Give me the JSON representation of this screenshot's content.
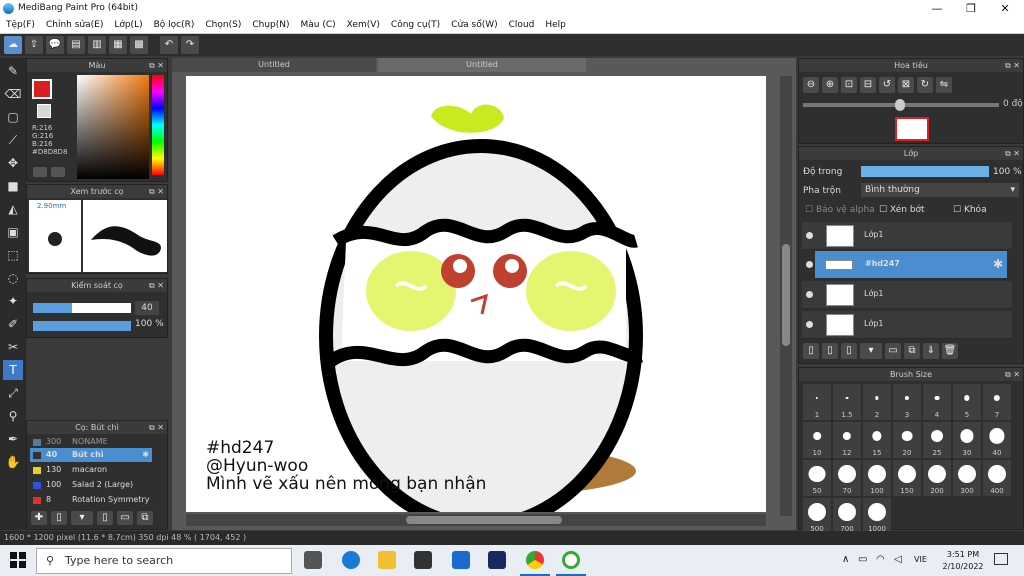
{
  "window": {
    "title": "MediBang Paint Pro (64bit)",
    "min": "—",
    "max": "❐",
    "close": "✕"
  },
  "menu": [
    "Tệp(F)",
    "Chỉnh sửa(E)",
    "Lớp(L)",
    "Bộ lọc(R)",
    "Chọn(S)",
    "Chụp(N)",
    "Màu (C)",
    "Xem(V)",
    "Công cụ(T)",
    "Cửa sổ(W)",
    "Cloud",
    "Help"
  ],
  "color_panel": {
    "title": "Màu",
    "r": "R:216",
    "g": "G:216",
    "b": "B:216",
    "hex": "#D8D8D8",
    "primary": "#d82020",
    "secondary": "#d8d8d8"
  },
  "brush_preview": {
    "title": "Xem trước cọ",
    "size": "2.90mm"
  },
  "brush_control": {
    "title": "Kiểm soát cọ",
    "size_value": "40",
    "opacity_value": "100",
    "opacity_unit": "%",
    "size_level": 0.4,
    "opacity_level": 1.0
  },
  "brush_list": {
    "title": "Cọ: Bút chì",
    "items": [
      {
        "value": "300",
        "label": "NONAME",
        "color": "#6ab0e8"
      },
      {
        "value": "40",
        "label": "Bút chì",
        "color": "#444444",
        "selected": true
      },
      {
        "value": "130",
        "label": "macaron",
        "color": "#e8d020"
      },
      {
        "value": "100",
        "label": "Salad 2 (Large)",
        "color": "#3050e0"
      },
      {
        "value": "8",
        "label": "Rotation Symmetry",
        "color": "#e03030"
      }
    ]
  },
  "tabs": [
    "Untitled",
    "Untitled"
  ],
  "canvas_text": {
    "line1": "#hd247",
    "line2": "@Hyun-woo",
    "line3": "Mình vẽ xấu nên mong bạn nhận"
  },
  "navigator": {
    "title": "Hoa tiêu",
    "angle": "0 độ"
  },
  "layer_panel": {
    "title": "Lớp",
    "opacity_label": "Độ trong",
    "opacity_value": "100 %",
    "blend_label": "Pha trộn",
    "blend_value": "Bình thường",
    "protect_alpha": "Bảo vệ alpha",
    "clipping": "Xén bớt",
    "lock": "Khóa",
    "layers": [
      {
        "name": "Lớp1"
      },
      {
        "name": "#hd247",
        "selected": true
      },
      {
        "name": "Lớp1"
      },
      {
        "name": "Lớp1"
      }
    ]
  },
  "brush_size": {
    "title": "Brush Size",
    "sizes": [
      "1",
      "1.5",
      "2",
      "3",
      "4",
      "5",
      "7",
      "10",
      "12",
      "15",
      "20",
      "25",
      "30",
      "40",
      "50",
      "70",
      "100",
      "150",
      "200",
      "300",
      "400",
      "500",
      "700",
      "1000"
    ]
  },
  "status": {
    "text": "1600 * 1200 pixel  (11.6 * 8.7cm)  350 dpi  48 %  ( 1704, 452 )"
  },
  "taskbar": {
    "search_placeholder": "Type here to search",
    "lang": "VIE",
    "time": "3:51 PM",
    "date": "2/10/2022"
  }
}
